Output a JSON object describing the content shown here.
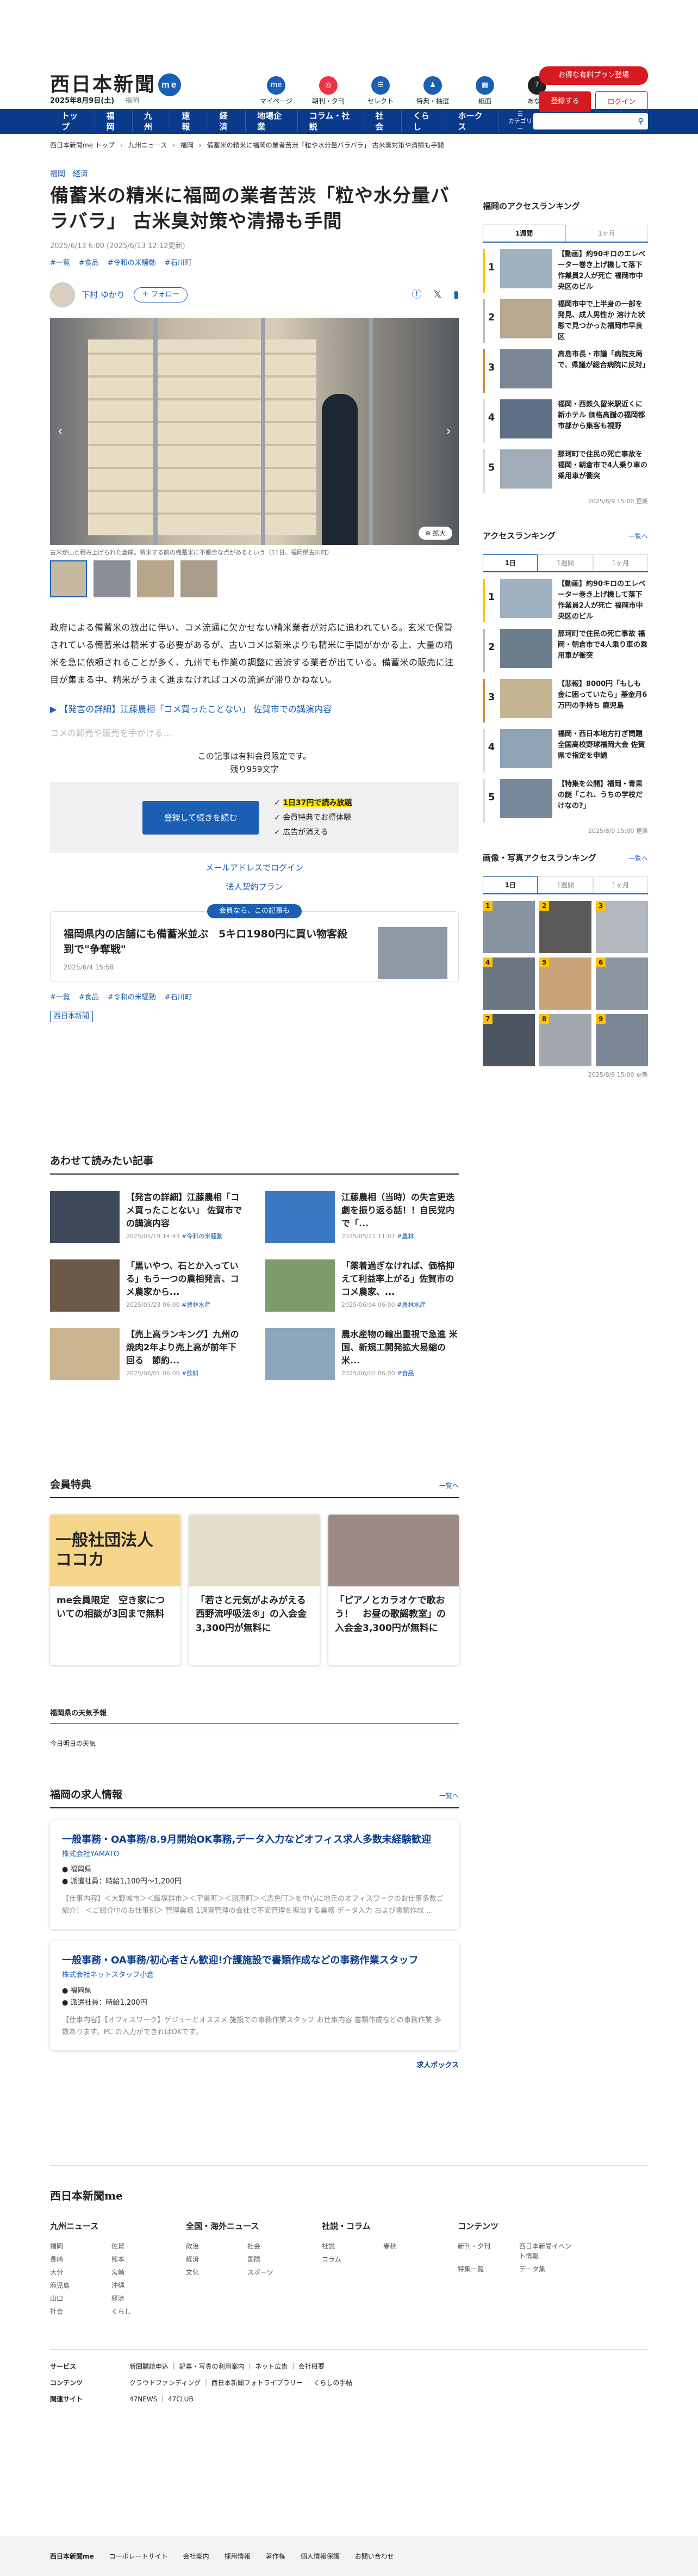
{
  "header": {
    "logo": "西日本新聞",
    "logo_badge": "me",
    "date": "2025年8月9日(土)",
    "region": "福岡",
    "icons": [
      {
        "label": "マイページ",
        "icon": "me"
      },
      {
        "label": "朝刊・夕刊",
        "icon": "news"
      },
      {
        "label": "セレクト",
        "icon": "select"
      },
      {
        "label": "特典・抽選",
        "icon": "gift"
      },
      {
        "label": "紙面",
        "icon": "paper"
      },
      {
        "label": "あな特",
        "icon": "anatoku"
      }
    ],
    "plan_button": "お得な有料プラン登場",
    "register_button": "登録する",
    "login_button": "ログイン"
  },
  "nav": {
    "items": [
      "トップ",
      "福岡",
      "九州",
      "速報",
      "経済",
      "地場企業",
      "コラム・社説",
      "社会",
      "くらし",
      "ホークス"
    ],
    "category": "カテゴリー",
    "search_icon": "search-icon"
  },
  "breadcrumb": [
    "西日本新聞me トップ",
    "九州ニュース",
    "福岡",
    "備蓄米の精米に福岡の業者苦渋「粒や水分量バラバラ」 古米臭対策や清掃も手間"
  ],
  "article": {
    "categories": "福岡　経済",
    "title": "備蓄米の精米に福岡の業者苦渋「粒や水分量バラバラ」 古米臭対策や清掃も手間",
    "date": "2025/6/13 6:00 (2025/6/13 12:12更新)",
    "tags": [
      "#一覧",
      "#食品",
      "#令和の米騒動",
      "#石川町"
    ],
    "author": "下村 ゆかり",
    "follow": "＋ フォロー",
    "photo_caption": "古米が山と積み上げられた倉庫。精米する前の備蓄米に不都合な点があるという（11日、福岡県古川町）",
    "zoom_label": "拡大",
    "body": "政府による備蓄米の放出に伴い、コメ流通に欠かせない精米業者が対応に追われている。玄米で保管されている備蓄米は精米する必要があるが、古いコメは新米よりも精米に手間がかかる上、大量の精米を急に依頼されることが多く、九州でも作業の調整に苦渋する業者が出ている。備蓄米の販売に注目が集まる中、精米がうまく進まなければコメの流通が滞りかねない。",
    "related": "【発言の詳細】江藤農相「コメ買ったことない」 佐賀市での講演内容",
    "fade": "コメの卸売や販売を手がける...",
    "paywall_msg": "この記事は有料会員限定です。",
    "remaining": "残り959文字",
    "paywall_button": "登録して続きを読む",
    "perks": [
      "1日37円で読み放題",
      "会員特典でお得体験",
      "広告が消える"
    ],
    "links": [
      "メールアドレスでログイン",
      "法人契約プラン"
    ],
    "member_label": "会員なら、この記事も",
    "member_title": "福岡県内の店舗にも備蓄米並ぶ　5キロ1980円に買い物客殺到で\"争奪戦\"",
    "member_date": "2025/6/4 15:58",
    "tags_bottom": [
      "#一覧",
      "#食品",
      "#令和の米騒動",
      "#石川町"
    ],
    "source": "西日本新聞"
  },
  "sidebar": {
    "rank_title": "福岡のアクセスランキング",
    "rank_tabs": [
      "1週間",
      "1ヶ月"
    ],
    "rank_items": [
      "【動画】約90キロのエレベーター巻き上げ機して落下 作業員2人が死亡 福岡市中央区のビル",
      "福岡市中で上半身の一部を発見、成人男性か 溶けた状態で見つかった福岡市早良区",
      "高島市長・市議「病院支局で、県議が総合病院に反対」",
      "福岡・西鉄久留米駅近くに新ホテル 価格高騰の福岡都市部から集客も視野",
      "那珂町で住民の死亡事故を福岡・朝倉市で4人乗り車の乗用車が衝突"
    ],
    "rank_updated": "2025/8/9 15:00 更新",
    "access_title": "アクセスランキング",
    "access_more": "一覧へ",
    "access_tabs": [
      "1日",
      "1週間",
      "1ヶ月"
    ],
    "access_items": [
      "【動画】約90キロのエレベーター巻き上げ機して落下 作業員2人が死亡 福岡市中央区のビル",
      "那珂町で住民の死亡事故 福岡・朝倉市で4人乗り車の乗用車が衝突",
      "【悲報】8000円「もしも金に困っていたら」基金月6万円の手持ち 鹿児島",
      "福岡・西日本地方打ぎ問題 全国高校野球福岡大会 佐賀県で指定を申請",
      "【特集を公開】福岡・青果の謎「これ、うちの学校だけなの?」"
    ],
    "access_updated": "2025/8/9 15:00 更新",
    "photo_title": "画像・写真アクセスランキング",
    "photo_more": "一覧へ",
    "photo_tabs": [
      "1日",
      "1週間",
      "1ヶ月"
    ],
    "photo_updated": "2025/8/9 15:00 更新"
  },
  "also_read": {
    "title": "あわせて読みたい記事",
    "items": [
      {
        "title": "【発言の詳細】江藤農相「コメ買ったことない」 佐賀市での講演内容",
        "meta": "2025/05/19 14:43",
        "tag": "#令和の米騒動"
      },
      {
        "title": "江藤農相（当時）の失言更迭劇を振り返る話！！自民党内で「...",
        "meta": "2025/05/21 11:07",
        "tag": "#農林"
      },
      {
        "title": "「黒いやつ、石とか入っている」もう一つの農相発言、コメ農家から...",
        "meta": "2025/05/23 06:00",
        "tag": "#農林水産"
      },
      {
        "title": "「薬着過ぎなければ、価格抑えて利益率上がる」佐賀市のコメ農家、...",
        "meta": "2025/06/04 06:00",
        "tag": "#農林水産"
      },
      {
        "title": "【売上高ランキング】九州の焼肉2年より売上高が前年下回る　節約...",
        "meta": "2025/06/01 06:00",
        "tag": "#飲料"
      },
      {
        "title": "農水産物の輸出重視で急進 米国、新規工開発拡大易縮の米...",
        "meta": "2025/06/02 06:00",
        "tag": "#食品"
      }
    ]
  },
  "perks_section": {
    "title": "会員特典",
    "more": "一覧へ",
    "items": [
      "me会員限定　空き家についての相談が3回まで無料",
      "「若さと元気がよみがえる西野流呼吸法®」の入会金3,300円が無料に",
      "「ピアノとカラオケで歌おう！　お昼の歌謡教室」の入会金3,300円が無料に"
    ],
    "image_text": "一般社団法人 ココカ"
  },
  "weather": {
    "title": "福岡県の天気予報",
    "text": "今日明日の天気"
  },
  "jobs": {
    "title": "福岡の求人情報",
    "more": "一覧へ",
    "items": [
      {
        "title": "一般事務・OA事務/8.9月開始OK事務,データ入力などオフィス求人多数未経験歓迎",
        "company": "株式会社YAMATO",
        "place": "福岡県",
        "pay": "派遣社員：時給1,100円〜1,200円",
        "desc": "【仕事内容】＜大野城市＞＜飯塚群市＞＜宇美町＞＜須恵町＞＜志免町＞を中心に地元のオフィスワークのお仕事多数ご紹介！ ＜ご紹介中のお仕事例＞ 管理業務 1週資管理の会社で不安管理を担当する業務 データ入力 および書類作成 ..."
      },
      {
        "title": "一般事務・OA事務/初心者さん歓迎!介護施設で書類作成などの事務作業スタッフ",
        "company": "株式会社ネットスタッフ小倉",
        "place": "福岡県",
        "pay": "派遣社員：時給1,200円",
        "desc": "【仕事内容】【オフィスワーク】ゲジューとオススメ 施設での事務作業スタッフ お仕事内容 書類作成などの事務作業 多数あります。PC の入力ができればOKです。"
      }
    ],
    "sponsor": "求人ボックス"
  },
  "footer": {
    "logo": "西日本新聞me",
    "cols": [
      {
        "title": "九州ニュース",
        "items": [
          "福岡",
          "佐賀",
          "長崎",
          "熊本",
          "大分",
          "宮崎",
          "鹿児島",
          "沖縄",
          "山口",
          "経済",
          "社会",
          "くらし"
        ]
      },
      {
        "title": "全国・海外ニュース",
        "items": [
          "政治",
          "社会",
          "経済",
          "国際",
          "文化",
          "スポーツ"
        ]
      },
      {
        "title": "社説・コラム",
        "items": [
          "社説",
          "春秋",
          "コラム"
        ]
      },
      {
        "title": "コンテンツ",
        "items": [
          "新刊・夕刊",
          "西日本新聞イベント情報",
          "特集一覧",
          "データ集"
        ]
      }
    ],
    "services_label": "サービス",
    "services": "新聞購読申込 ｜ 記事・写真の利用案内 ｜ ネット広告 ｜ 会社概要",
    "content_label": "コンテンツ",
    "content": "クラウドファンディング ｜ 西日本新聞フォトライブラリー ｜ くらしの手帖",
    "related_label": "関連サイト",
    "related": "47NEWS ｜ 47CLUB",
    "bottom_links": [
      "コーポレートサイト",
      "会社案内",
      "採用情報",
      "著作権",
      "個人情報保護",
      "お問い合わせ"
    ]
  },
  "colors": {
    "accent": "#1a5fb4",
    "nav": "#0a3a8c",
    "red": "#d71920"
  }
}
